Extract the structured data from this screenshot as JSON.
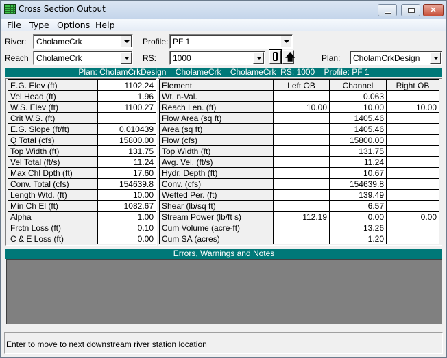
{
  "window": {
    "title": "Cross Section Output",
    "icon": "table-grid-icon",
    "controls": {
      "minimize": "minimize-icon",
      "maximize": "maximize-icon",
      "close": "close-icon"
    }
  },
  "menu": [
    "File",
    "Type",
    "Options",
    "Help"
  ],
  "selectors": {
    "river_label": "River:",
    "river_value": "CholameCrk",
    "reach_label": "Reach",
    "reach_value": "CholameCrk",
    "profile_label": "Profile:",
    "profile_value": "PF 1",
    "rs_label": "RS:",
    "rs_value": "1000",
    "plan_label": "Plan:",
    "plan_value": "CholamCrkDesign",
    "next_downstream_icon": "downstream-arrow-icon",
    "next_upstream_icon": "up-arrow-icon"
  },
  "header_bar": "Plan: CholamCrkDesign    CholameCrk    CholameCrk  RS: 1000    Profile: PF 1",
  "summary_table": [
    {
      "label": "E.G. Elev (ft)",
      "value": "1102.24"
    },
    {
      "label": "Vel Head (ft)",
      "value": "1.96"
    },
    {
      "label": "W.S. Elev (ft)",
      "value": "1100.27"
    },
    {
      "label": "Crit W.S. (ft)",
      "value": ""
    },
    {
      "label": "E.G. Slope (ft/ft)",
      "value": "0.010439"
    },
    {
      "label": "Q Total (cfs)",
      "value": "15800.00"
    },
    {
      "label": "Top Width (ft)",
      "value": "131.75"
    },
    {
      "label": "Vel Total (ft/s)",
      "value": "11.24"
    },
    {
      "label": "Max Chl Dpth (ft)",
      "value": "17.60"
    },
    {
      "label": "Conv. Total (cfs)",
      "value": "154639.8"
    },
    {
      "label": "Length Wtd. (ft)",
      "value": "10.00"
    },
    {
      "label": "Min Ch El (ft)",
      "value": "1082.67"
    },
    {
      "label": "Alpha",
      "value": "1.00"
    },
    {
      "label": "Frctn Loss (ft)",
      "value": "0.10"
    },
    {
      "label": "C & E Loss (ft)",
      "value": "0.00"
    }
  ],
  "element_table": {
    "headers": [
      "Element",
      "Left OB",
      "Channel",
      "Right OB"
    ],
    "rows": [
      {
        "label": "Wt. n-Val.",
        "left": "",
        "channel": "0.063",
        "right": ""
      },
      {
        "label": "Reach Len. (ft)",
        "left": "10.00",
        "channel": "10.00",
        "right": "10.00"
      },
      {
        "label": "Flow Area (sq ft)",
        "left": "",
        "channel": "1405.46",
        "right": ""
      },
      {
        "label": "Area (sq ft)",
        "left": "",
        "channel": "1405.46",
        "right": ""
      },
      {
        "label": "Flow (cfs)",
        "left": "",
        "channel": "15800.00",
        "right": ""
      },
      {
        "label": "Top Width (ft)",
        "left": "",
        "channel": "131.75",
        "right": ""
      },
      {
        "label": "Avg. Vel. (ft/s)",
        "left": "",
        "channel": "11.24",
        "right": ""
      },
      {
        "label": "Hydr. Depth (ft)",
        "left": "",
        "channel": "10.67",
        "right": ""
      },
      {
        "label": "Conv. (cfs)",
        "left": "",
        "channel": "154639.8",
        "right": ""
      },
      {
        "label": "Wetted Per. (ft)",
        "left": "",
        "channel": "139.49",
        "right": ""
      },
      {
        "label": "Shear (lb/sq ft)",
        "left": "",
        "channel": "6.57",
        "right": ""
      },
      {
        "label": "Stream Power (lb/ft s)",
        "left": "112.19",
        "channel": "0.00",
        "right": "0.00"
      },
      {
        "label": "Cum Volume (acre-ft)",
        "left": "",
        "channel": "13.26",
        "right": ""
      },
      {
        "label": "Cum SA (acres)",
        "left": "",
        "channel": "1.20",
        "right": ""
      }
    ]
  },
  "notes": {
    "title": "Errors, Warnings and Notes",
    "content": ""
  },
  "status_bar": "Enter to move to next downstream river station location",
  "colors": {
    "teal_header": "#007878",
    "notes_background": "#808080",
    "window_background": "#f0f0f0"
  }
}
